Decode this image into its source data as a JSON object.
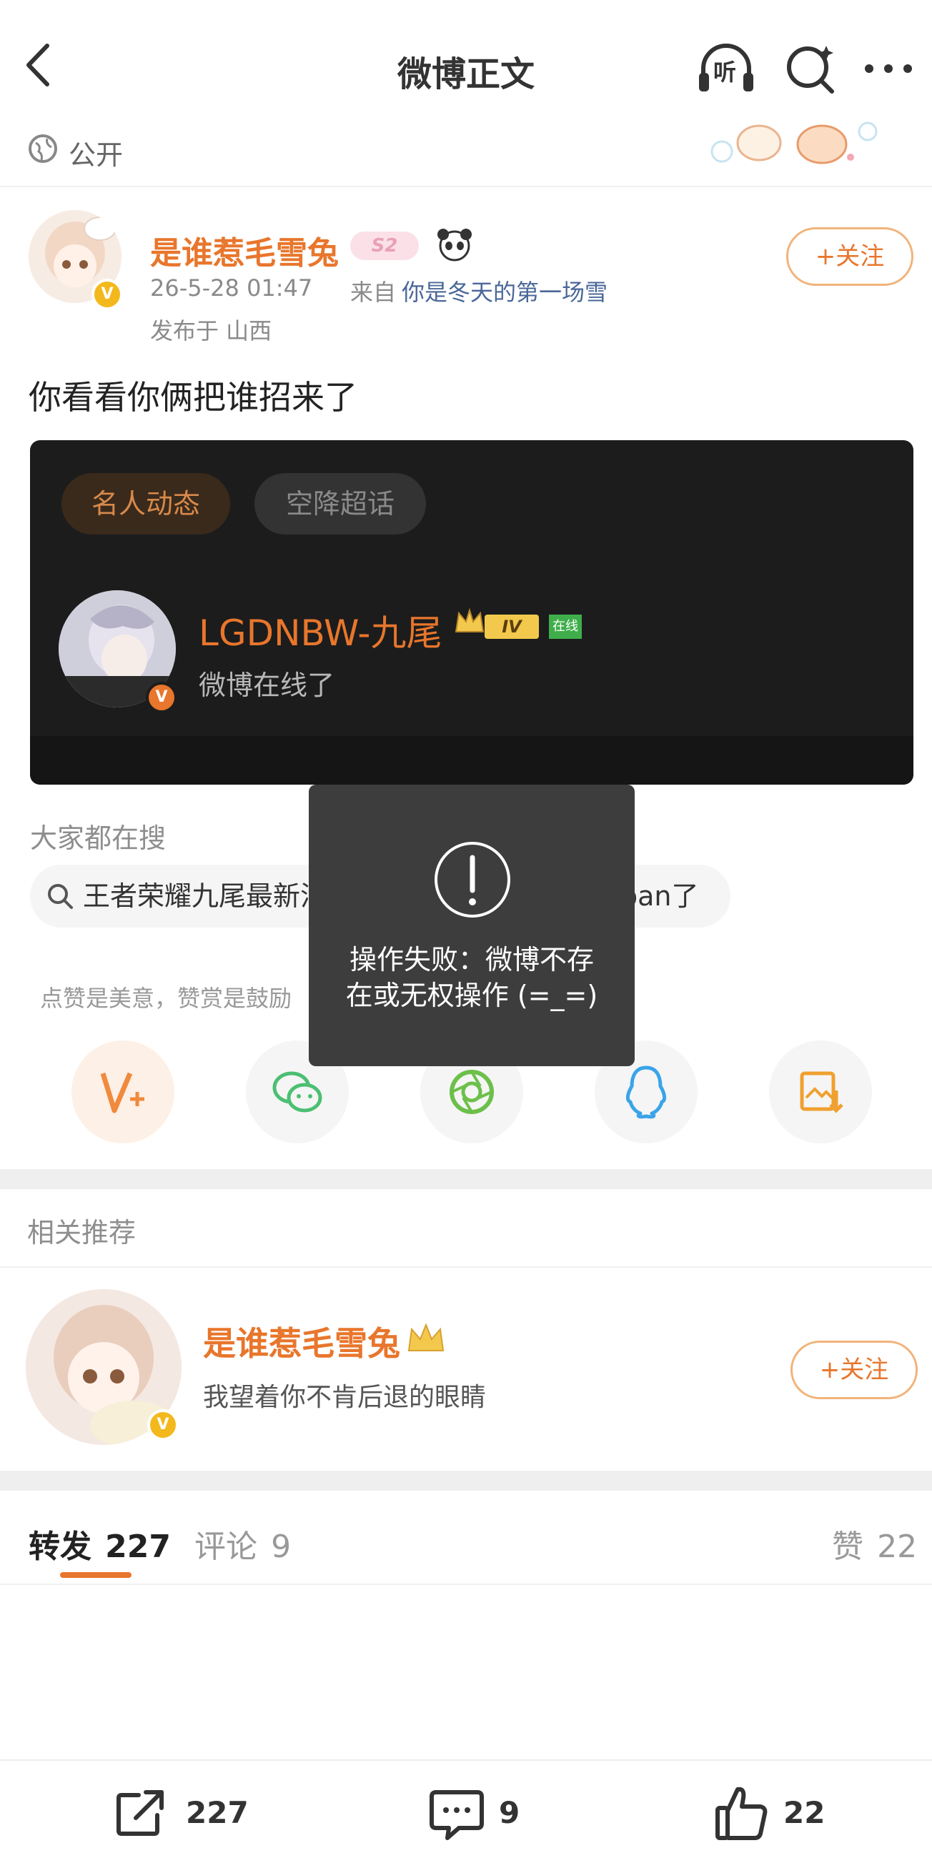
{
  "nav": {
    "title": "微博正文",
    "listen_label": "听"
  },
  "visibility": {
    "label": "公开"
  },
  "post": {
    "author": "是谁惹毛雪兔",
    "level_badge": "S2",
    "time": "26-5-28 01:47",
    "source_prefix": "来自",
    "source": "你是冬天的第一场雪",
    "location": "发布于 山西",
    "follow_label": "+关注",
    "content": "你看看你俩把谁招来了"
  },
  "card": {
    "tabs": [
      {
        "label": "名人动态"
      },
      {
        "label": "空降超话"
      }
    ],
    "user_name": "LGDNBW-九尾",
    "level_badge": "IV",
    "online_badge": "在线",
    "status": "微博在线了"
  },
  "search": {
    "title": "大家都在搜",
    "chips": [
      {
        "label": "王者荣耀九尾最新消息"
      },
      {
        "label": "九尾为什么被ban了"
      }
    ]
  },
  "reward": {
    "text": "点赞是美意，赞赏是鼓励"
  },
  "share": {
    "items": [
      {
        "icon": "weibo-reward-icon",
        "color": "#f08a3c"
      },
      {
        "icon": "wechat-icon",
        "color": "#4cbf72"
      },
      {
        "icon": "moments-icon",
        "color": "#6cc04a"
      },
      {
        "icon": "qq-icon",
        "color": "#3aa4e8"
      },
      {
        "icon": "save-image-icon",
        "color": "#f0a030"
      }
    ]
  },
  "recommend": {
    "title": "相关推荐",
    "user_name": "是谁惹毛雪兔",
    "bio": "我望着你不肯后退的眼睛",
    "follow_label": "+关注"
  },
  "tabs": {
    "repost_label": "转发",
    "repost_count": "227",
    "comment_label": "评论",
    "comment_count": "9",
    "like_label": "赞",
    "like_count": "22"
  },
  "bottom": {
    "repost_count": "227",
    "comment_count": "9",
    "like_count": "22"
  },
  "toast": {
    "line1": "操作失败：微博不存",
    "line2": "在或无权操作 (=_=)"
  },
  "colors": {
    "accent": "#e8762c",
    "card_bg": "#1c1c1c",
    "toast_bg": "#3d3d3d"
  }
}
